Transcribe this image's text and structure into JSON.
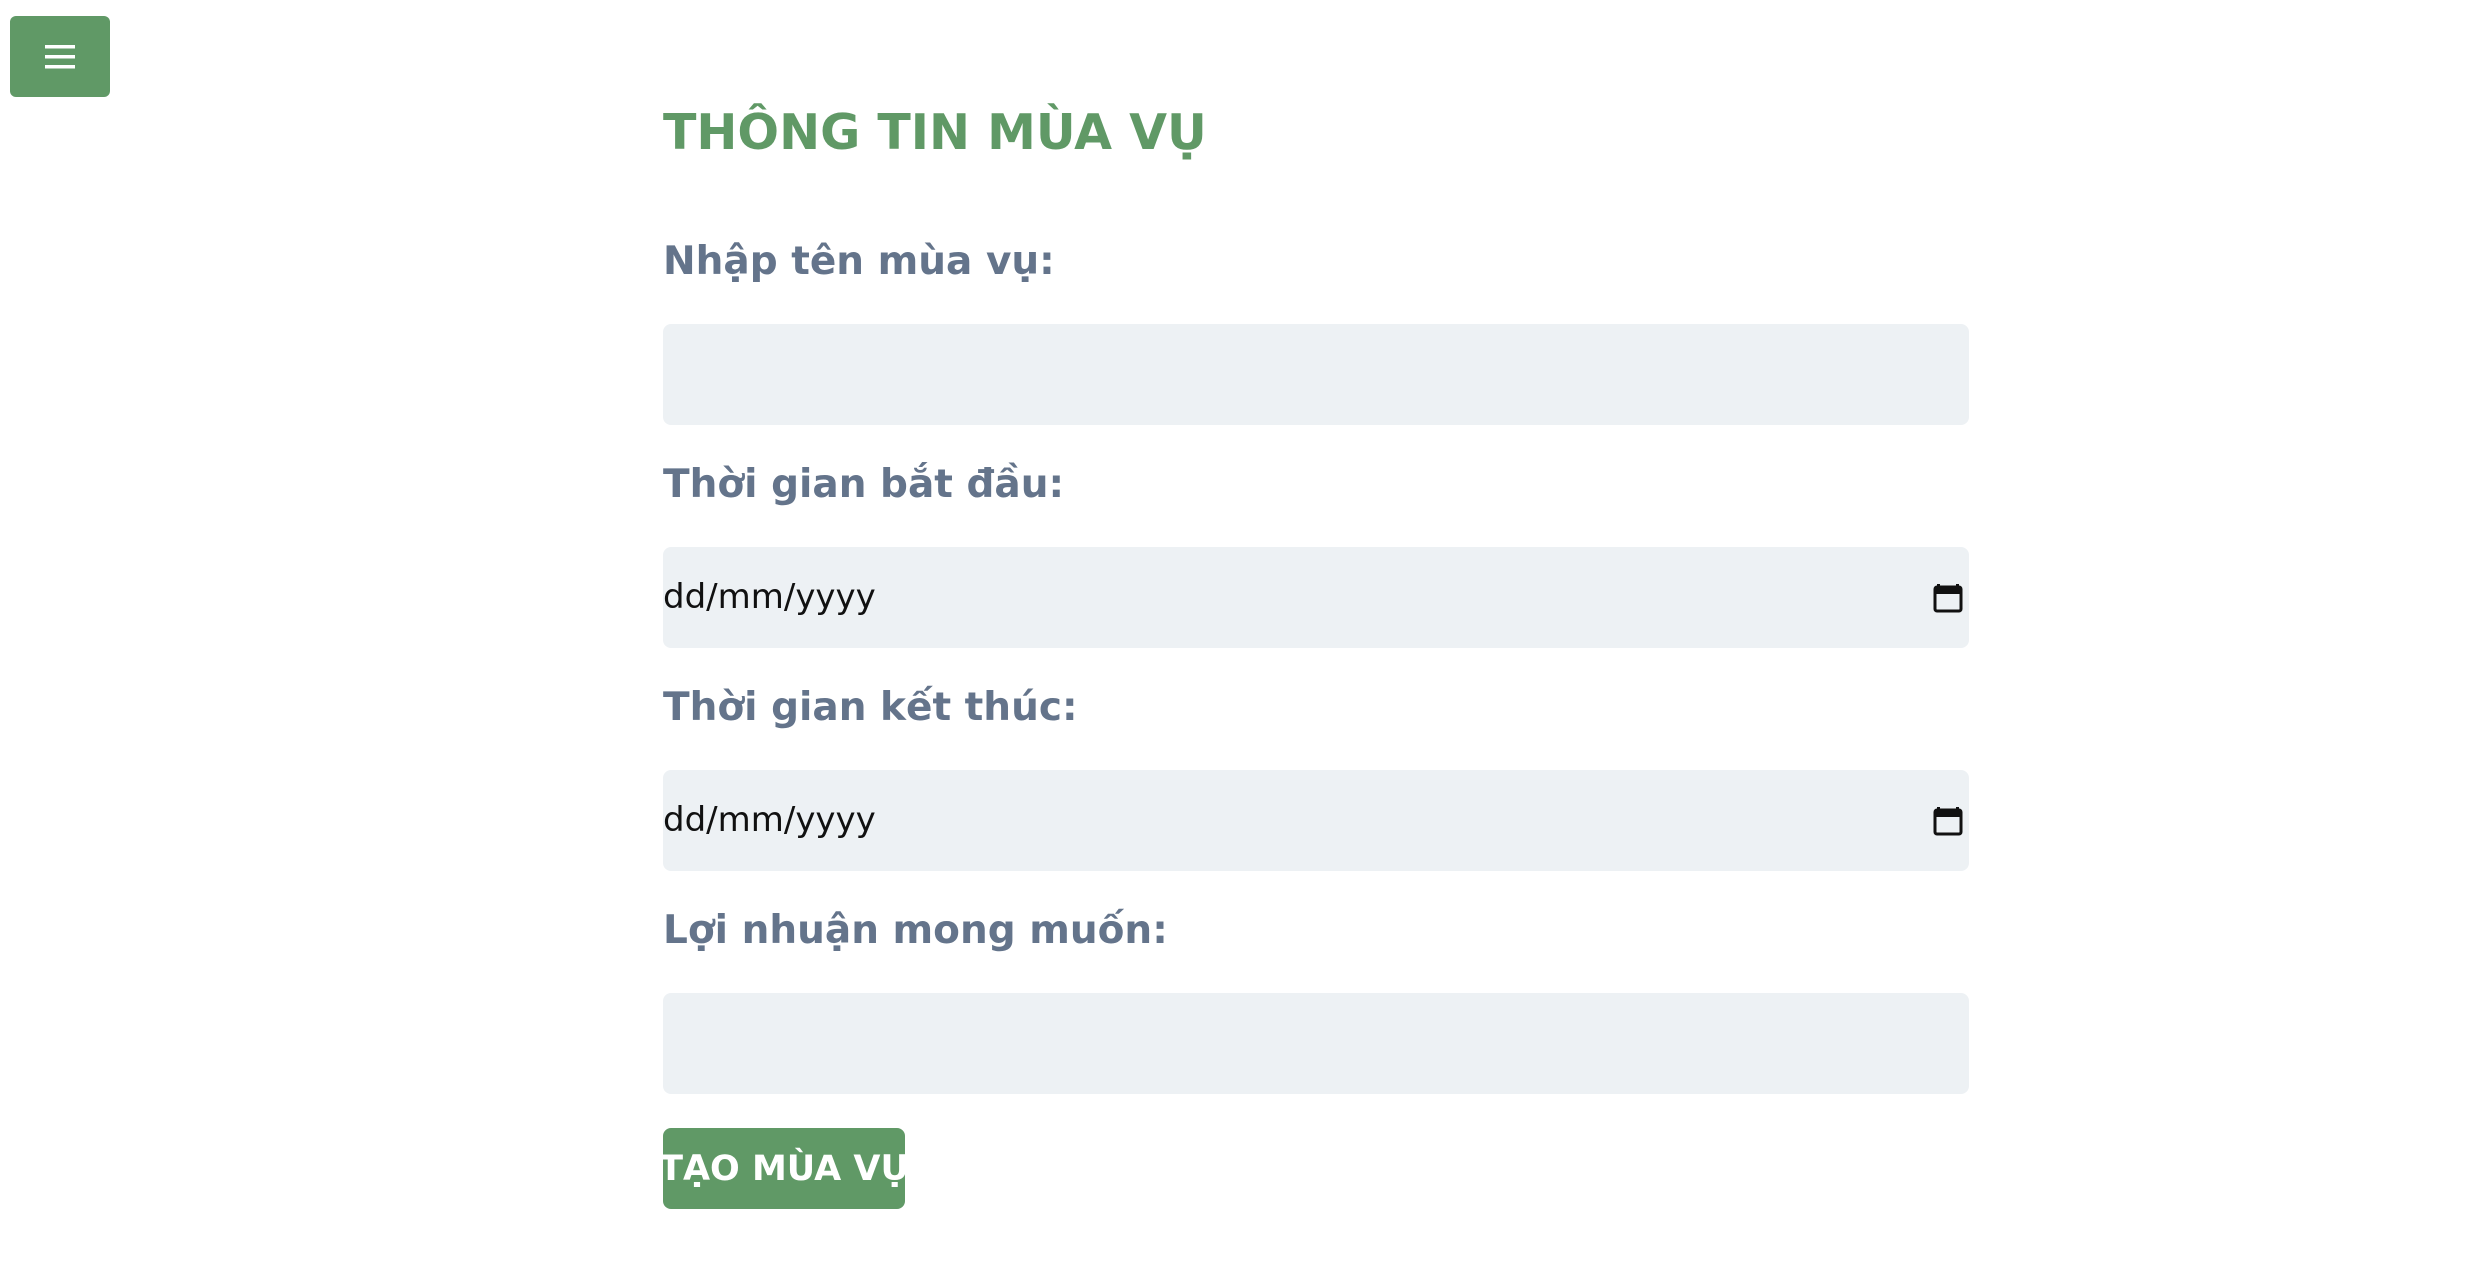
{
  "menu": {
    "icon": "hamburger-menu-icon"
  },
  "form": {
    "title": "THÔNG TIN MÙA VỤ",
    "season_name": {
      "label": "Nhập tên mùa vụ:",
      "value": ""
    },
    "start_date": {
      "label": "Thời gian bắt đầu:",
      "placeholder": "dd/mm/yyyy",
      "icon": "calendar-icon"
    },
    "end_date": {
      "label": "Thời gian kết thúc:",
      "placeholder": "dd/mm/yyyy",
      "icon": "calendar-icon"
    },
    "expected_profit": {
      "label": "Lợi nhuận mong muốn:",
      "value": ""
    },
    "submit_label": "TẠO MÙA VỤ"
  },
  "colors": {
    "accent": "#609966",
    "label": "#64748b",
    "field_bg": "#edf1f4"
  }
}
